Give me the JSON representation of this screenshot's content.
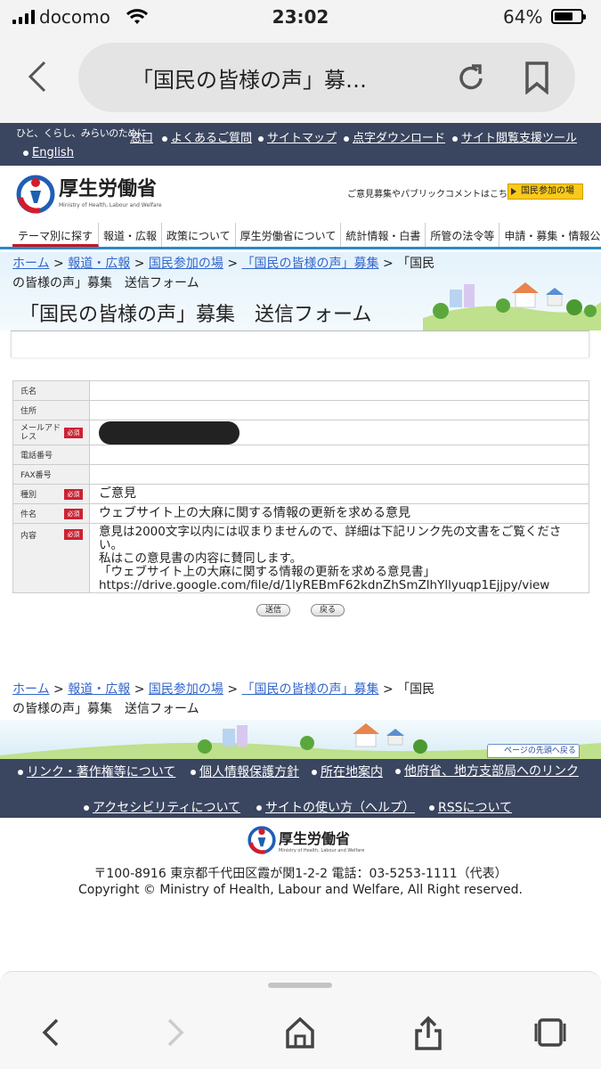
{
  "status_bar": {
    "carrier": "docomo",
    "time": "23:02",
    "battery": "64%"
  },
  "browser": {
    "tab_title": "「国民の皆様の声」募…"
  },
  "utility_nav": {
    "tagline": "ひと、くらし、みらいのために",
    "links": [
      "窓口",
      "よくあるご質問",
      "サイトマップ",
      "点字ダウンロード",
      "サイト閲覧支援ツール",
      "English"
    ]
  },
  "header": {
    "logo_name": "厚生労働省",
    "logo_en": "Ministry of Health, Labour and Welfare",
    "note": "ご意見募集やパブリックコメントはこちら",
    "participation_button": "国民参加の場"
  },
  "global_nav": [
    "テーマ別に探す",
    "報道・広報",
    "政策について",
    "厚生労働省について",
    "統計情報・白書",
    "所管の法令等",
    "申請・募集・情報公開"
  ],
  "breadcrumb": {
    "links": [
      "ホーム",
      "報道・広報",
      "国民参加の場",
      "「国民の皆様の声」募集"
    ],
    "separator": ">",
    "current_line1": "「国民",
    "current_line2": "の皆様の声」募集　送信フォーム"
  },
  "page_title": "「国民の皆様の声」募集　送信フォーム",
  "form": {
    "required_label": "必須",
    "fields": [
      {
        "label": "氏名",
        "value": ""
      },
      {
        "label": "住所",
        "value": ""
      },
      {
        "label": "メールアドレス",
        "value": ""
      },
      {
        "label": "電話番号",
        "value": ""
      },
      {
        "label": "FAX番号",
        "value": ""
      },
      {
        "label": "種別",
        "value": "ご意見"
      },
      {
        "label": "件名",
        "value": "ウェブサイト上の大麻に関する情報の更新を求める意見"
      },
      {
        "label": "内容",
        "value_lines": [
          "意見は2000文字以内には収まりませんので、詳細は下記リンク先の文書をご覧ください。",
          "私はこの意見書の内容に賛同します。",
          "「ウェブサイト上の大麻に関する情報の更新を求める意見書」",
          "https://drive.google.com/file/d/1lyREBmF62kdnZhSmZlhYllyuqp1Ejjpy/view"
        ]
      }
    ],
    "submit": "送信",
    "back": "戻る"
  },
  "to_top": "ページの先頭へ戻る",
  "footer_nav": [
    "リンク・著作権等について",
    "個人情報保護方針",
    "所在地案内",
    "他府省、地方支部局へのリンク",
    "アクセシビリティについて",
    "サイトの使い方（ヘルプ）",
    "RSSについて"
  ],
  "footer": {
    "address": "〒100-8916 東京都千代田区霞が関1-2-2 電話：03-5253-1111（代表）",
    "copyright": "Copyright © Ministry of Health, Labour and Welfare, All Right reserved."
  }
}
